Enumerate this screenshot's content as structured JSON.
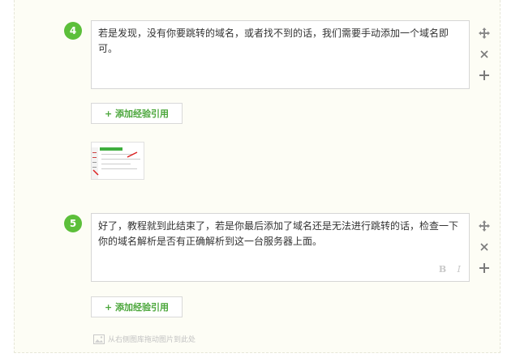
{
  "steps": [
    {
      "number": "4",
      "text": "若是发现，没有你要跳转的域名，或者找不到的话，我们需要手动添加一个域名即可。"
    },
    {
      "number": "5",
      "text": "好了，教程就到此结束了，若是你最后添加了域名还是无法进行跳转的话，检查一下你的域名解析是否有正确解析到这一台服务器上面。",
      "format_bold": "B",
      "format_italic": "I"
    }
  ],
  "add_experience_label": "+ 添加经验引用",
  "drag_hint": "从右侧图库拖动图片到此处",
  "colors": {
    "accent_green": "#5cbf3a",
    "button_text_green": "#4aa63a",
    "panel_bg": "#fdfdf5"
  },
  "icons": [
    "move-icon",
    "close-icon",
    "plus-icon",
    "image-icon"
  ]
}
